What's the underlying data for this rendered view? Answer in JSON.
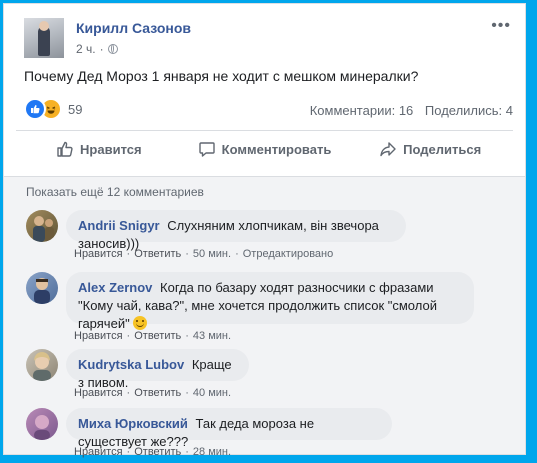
{
  "post": {
    "author": "Кирилл Сазонов",
    "time": "2 ч.",
    "text": "Почему Дед Мороз 1 января не ходит с мешком минералки?",
    "reactions_count": "59",
    "comments_count": "Комментарии: 16",
    "shares_count": "Поделились: 4",
    "more_glyph": "•••"
  },
  "actions": {
    "like": "Нравится",
    "comment": "Комментировать",
    "share": "Поделиться"
  },
  "comments_section": {
    "show_more": "Показать ещё 12 комментариев"
  },
  "comments": [
    {
      "author": "Andrii Snigyr",
      "text": "Слухняним хлопчикам, він звечора заносив)))",
      "like": "Нравится",
      "reply": "Ответить",
      "time": "50 мин.",
      "edited": "Отредактировано"
    },
    {
      "author": "Alex Zernov",
      "text": "Когда по базару ходят разносчики с фразами \"Кому чай, кава?\", мне хочется продолжить список \"смолой гарячей\"",
      "like": "Нравится",
      "reply": "Ответить",
      "time": "43 мин."
    },
    {
      "author": "Kudrytska Lubov",
      "text": "Краще з пивом.",
      "like": "Нравится",
      "reply": "Ответить",
      "time": "40 мин."
    },
    {
      "author": "Миха Юрковский",
      "text": "Так деда мороза не существует же???",
      "like": "Нравится",
      "reply": "Ответить",
      "time": "28 мин."
    }
  ],
  "separator": "·",
  "colors": {
    "background": "#00a6ec",
    "link": "#385898",
    "bubble": "#e9ebee",
    "like_reaction": "#2078f4",
    "haha_reaction": "#f7b125"
  }
}
